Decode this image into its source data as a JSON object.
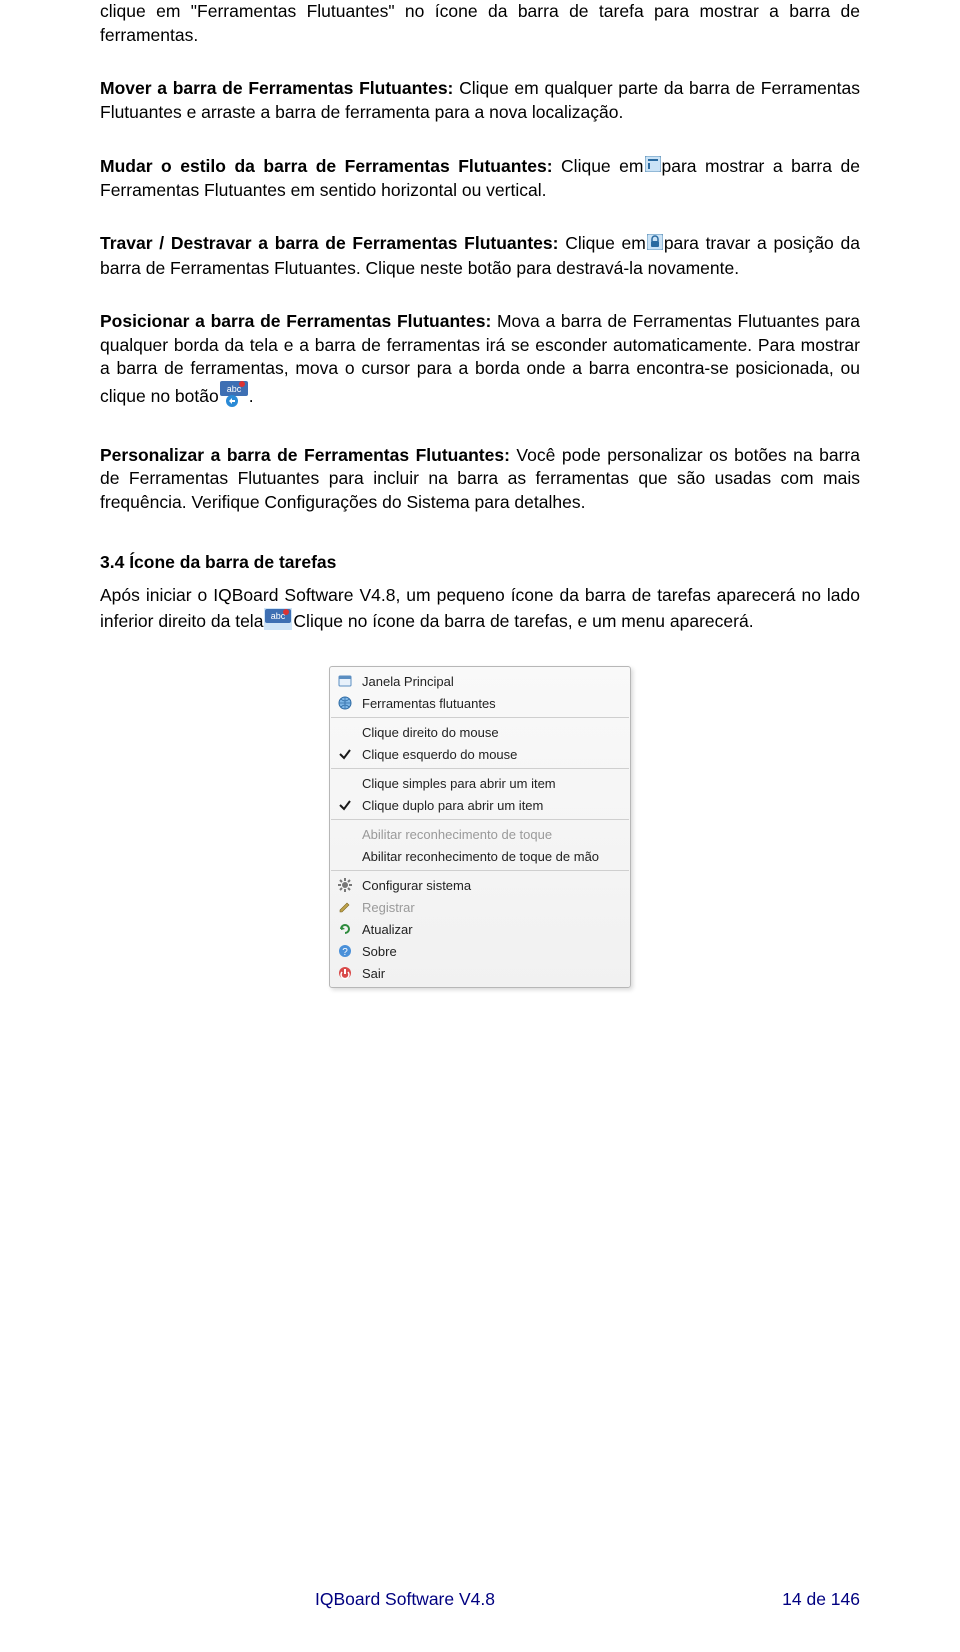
{
  "para1": {
    "text": "clique em \"Ferramentas Flutuantes\" no ícone da barra de tarefa para mostrar a barra de ferramentas."
  },
  "para2": {
    "bold": "Mover a barra de Ferramentas Flutuantes: ",
    "rest": "Clique em qualquer parte da barra de Ferramentas Flutuantes e arraste a barra de ferramenta para a nova localização."
  },
  "para3": {
    "bold": "Mudar o estilo da barra de Ferramentas Flutuantes: ",
    "pre": "Clique em",
    "post": "para mostrar a barra de Ferramentas Flutuantes em sentido horizontal ou vertical."
  },
  "para4": {
    "bold": "Travar / Destravar a barra de Ferramentas Flutuantes: ",
    "pre": "Clique em",
    "post": "para travar a posição da barra de Ferramentas Flutuantes. Clique neste botão para destravá-la novamente."
  },
  "para5": {
    "bold": "Posicionar a barra de Ferramentas Flutuantes: ",
    "pre": "Mova a barra de Ferramentas Flutuantes para qualquer borda da tela e a barra de ferramentas irá se esconder automaticamente. Para mostrar a barra de ferramentas, mova o cursor para a borda onde a barra encontra-se posicionada, ou clique no botão",
    "post": "."
  },
  "para6": {
    "bold": "Personalizar a barra de Ferramentas Flutuantes: ",
    "rest": "Você pode personalizar os botões na barra de Ferramentas Flutuantes para incluir na barra as ferramentas que são usadas com mais frequência. Verifique Configurações do Sistema para detalhes."
  },
  "section_heading": "3.4 Ícone da barra de tarefas",
  "para7": {
    "pre": "Após iniciar o IQBoard Software V4.8, um pequeno ícone da barra de tarefas aparecerá no lado inferior direito da tela",
    "post": "Clique no ícone da barra de tarefas, e um menu aparecerá."
  },
  "menu": {
    "items": [
      {
        "label": "Janela Principal",
        "icon": "window",
        "disabled": false,
        "checked": false
      },
      {
        "label": "Ferramentas flutuantes",
        "icon": "globe",
        "disabled": false,
        "checked": false
      },
      {
        "sep": true
      },
      {
        "label": "Clique direito do mouse",
        "icon": "",
        "disabled": false,
        "checked": false
      },
      {
        "label": "Clique esquerdo do mouse",
        "icon": "check",
        "disabled": false,
        "checked": true
      },
      {
        "sep": true
      },
      {
        "label": "Clique simples para abrir um item",
        "icon": "",
        "disabled": false,
        "checked": false
      },
      {
        "label": "Clique duplo para abrir um item",
        "icon": "check",
        "disabled": false,
        "checked": true
      },
      {
        "sep": true
      },
      {
        "label": "Abilitar reconhecimento de toque",
        "icon": "",
        "disabled": true,
        "checked": false
      },
      {
        "label": "Abilitar reconhecimento de toque de mão",
        "icon": "",
        "disabled": false,
        "checked": false
      },
      {
        "sep": true
      },
      {
        "label": "Configurar sistema",
        "icon": "gear",
        "disabled": false,
        "checked": false
      },
      {
        "label": "Registrar",
        "icon": "pencil",
        "disabled": true,
        "checked": false
      },
      {
        "label": "Atualizar",
        "icon": "refresh",
        "disabled": false,
        "checked": false
      },
      {
        "label": "Sobre",
        "icon": "help",
        "disabled": false,
        "checked": false
      },
      {
        "label": "Sair",
        "icon": "exit",
        "disabled": false,
        "checked": false
      }
    ]
  },
  "footer": {
    "center": "IQBoard Software V4.8",
    "right": "14 de 146"
  }
}
